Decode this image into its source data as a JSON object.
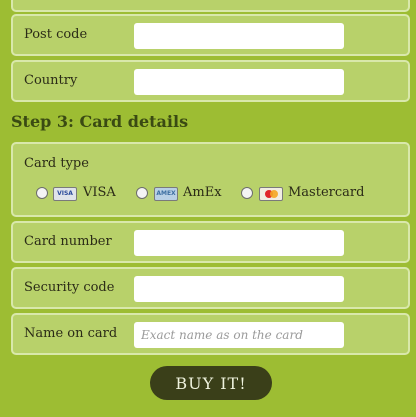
{
  "address": {
    "post_code_label": "Post code",
    "post_code_value": "",
    "country_label": "Country",
    "country_value": ""
  },
  "step3": {
    "title": "Step 3: Card details"
  },
  "card_type": {
    "label": "Card type",
    "options": [
      {
        "label": "VISA",
        "icon": "visa-card-icon",
        "icon_text": "VISA",
        "selected": false
      },
      {
        "label": "AmEx",
        "icon": "amex-card-icon",
        "icon_text": "AMEX",
        "selected": false
      },
      {
        "label": "Mastercard",
        "icon": "mastercard-card-icon",
        "selected": false
      }
    ]
  },
  "card_number": {
    "label": "Card number",
    "value": ""
  },
  "security_code": {
    "label": "Security code",
    "value": ""
  },
  "name_on_card": {
    "label": "Name on card",
    "value": "",
    "placeholder": "Exact name as on the card"
  },
  "buy_button": {
    "label": "BUY IT!"
  },
  "colors": {
    "background": "#9dbd33",
    "panel": "#b8d16a",
    "panel_border": "#d9e8ab",
    "heading": "#3a4a13",
    "button": "#3a3f19"
  }
}
